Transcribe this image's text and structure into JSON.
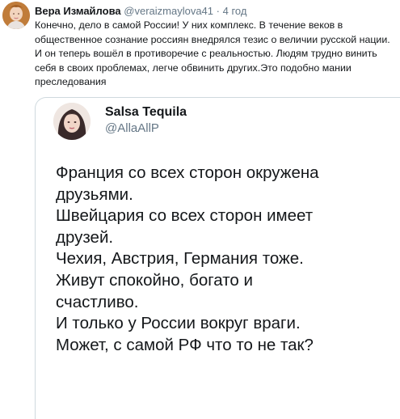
{
  "post": {
    "author_name": "Вера Измайлова",
    "author_handle": "@veraizmaylova41",
    "separator": "·",
    "time": "4 год",
    "text": "Конечно, дело в самой России! У них комплекс. В течение веков в общественное сознание россиян внедрялся тезис о величии русской нации. И он теперь вошёл в противоречие с реальностью. Людям трудно винить себя в своих проблемах, легче обвинить других.Это подобно мании преследования"
  },
  "quoted": {
    "author_name": "Salsa Tequila",
    "author_handle": "@AllaAllP",
    "lines": [
      "Франция со всех сторон окружена",
      "друзьями.",
      "Швейцария со всех сторон имеет",
      "друзей.",
      "Чехия, Австрия, Германия тоже.",
      "Живут спокойно, богато  и",
      "счастливо.",
      "И только у России вокруг враги.",
      "Может, с самой РФ что то не так?"
    ]
  },
  "icons": {
    "avatar": "user-avatar-photo",
    "quoted_avatar": "quoted-user-avatar-photo"
  }
}
